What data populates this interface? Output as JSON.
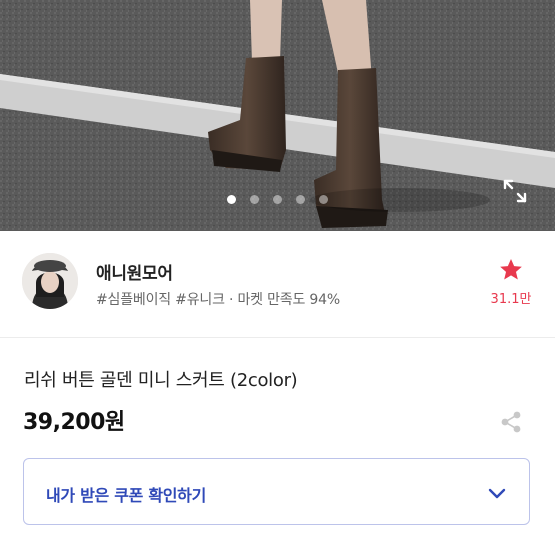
{
  "gallery": {
    "dot_count": 5,
    "active_index": 0,
    "expand_icon": "expand-icon"
  },
  "seller": {
    "name": "애니원모어",
    "tags": "#심플베이직 #유니크 · 마켓 만족도 94%",
    "favorite_count": "31.1만",
    "favorite_icon": "star-icon",
    "accent_color": "#e8394e"
  },
  "product": {
    "name": "리쉬 버튼 골덴 미니 스커트 (2color)",
    "price": "39,200원",
    "share_icon": "share-icon"
  },
  "coupon": {
    "label": "내가 받은 쿠폰 확인하기",
    "chevron_icon": "chevron-down-icon",
    "accent_color": "#2f49b8"
  }
}
